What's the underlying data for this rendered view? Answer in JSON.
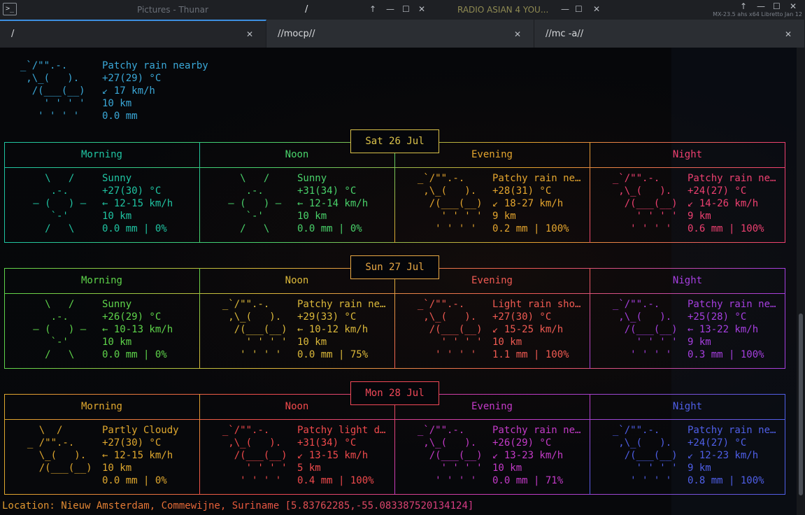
{
  "taskbar": {
    "menu_icon_glyph": ">_",
    "windows": [
      {
        "title": "Pictures - Thunar"
      },
      {
        "title": "/"
      },
      {
        "title": "RADIO ASIAN 4 YOU..."
      }
    ],
    "window_controls": {
      "minimize": "—",
      "maximize": "☐",
      "close": "✕"
    },
    "tray_controls": {
      "up": "↑",
      "minimize": "—",
      "maximize": "☐",
      "close": "✕"
    },
    "sysinfo": "MX-23.5  ahs  x64 Libretto  Jan 12"
  },
  "tabs": [
    {
      "label": "/",
      "active": true
    },
    {
      "label": "//mocp//",
      "active": false
    },
    {
      "label": "//mc -a//",
      "active": false
    }
  ],
  "tab_close_glyph": "✕",
  "current": {
    "art": [
      " _`/\"\".-.    ",
      "  ,\\_(   ).  ",
      "   /(___(__) ",
      "     ' ' ' ' ",
      "    ' ' ' '  "
    ],
    "lines": [
      "Patchy rain nearby",
      "+27(29) °C",
      "↙ 17 km/h",
      "10 km",
      "0.0 mm"
    ],
    "color": "#3aa8d8"
  },
  "days": [
    {
      "date": "Sat 26 Jul",
      "date_color": "#d9c14a",
      "periods": [
        {
          "name": "Morning",
          "color": "#1fc4a2",
          "art": [
            "    \\   /    ",
            "     .-.     ",
            "  ― (   ) ―  ",
            "     `-'     ",
            "    /   \\    "
          ],
          "lines": [
            "Sunny",
            "+27(30) °C",
            "← 12-15 km/h",
            "10 km",
            "0.0 mm | 0%"
          ]
        },
        {
          "name": "Noon",
          "color": "#49d26a",
          "art": [
            "    \\   /    ",
            "     .-.     ",
            "  ― (   ) ―  ",
            "     `-'     ",
            "    /   \\    "
          ],
          "lines": [
            "Sunny",
            "+31(34) °C",
            "← 12-14 km/h",
            "10 km",
            "0.0 mm | 0%"
          ]
        },
        {
          "name": "Evening",
          "color": "#e4a52e",
          "art": [
            " _`/\"\".-.    ",
            "  ,\\_(   ).  ",
            "   /(___(__) ",
            "     ' ' ' ' ",
            "    ' ' ' '  "
          ],
          "lines": [
            "Patchy rain ne…",
            "+28(31) °C",
            "↙ 18-27 km/h",
            "9 km",
            "0.2 mm | 100%"
          ]
        },
        {
          "name": "Night",
          "color": "#ee4070",
          "art": [
            " _`/\"\".-.    ",
            "  ,\\_(   ).  ",
            "   /(___(__) ",
            "     ' ' ' ' ",
            "    ' ' ' '  "
          ],
          "lines": [
            "Patchy rain ne…",
            "+24(27) °C",
            "↙ 14-26 km/h",
            "9 km",
            "0.6 mm | 100%"
          ]
        }
      ]
    },
    {
      "date": "Sun 27 Jul",
      "date_color": "#e8a844",
      "periods": [
        {
          "name": "Morning",
          "color": "#5ed44a",
          "art": [
            "    \\   /    ",
            "     .-.     ",
            "  ― (   ) ―  ",
            "     `-'     ",
            "    /   \\    "
          ],
          "lines": [
            "Sunny",
            "+26(29) °C",
            "← 10-13 km/h",
            "10 km",
            "0.0 mm | 0%"
          ]
        },
        {
          "name": "Noon",
          "color": "#dcb93a",
          "art": [
            " _`/\"\".-.    ",
            "  ,\\_(   ).  ",
            "   /(___(__) ",
            "     ' ' ' ' ",
            "    ' ' ' '  "
          ],
          "lines": [
            "Patchy rain ne…",
            "+29(33) °C",
            "← 10-12 km/h",
            "10 km",
            "0.0 mm | 75%"
          ]
        },
        {
          "name": "Evening",
          "color": "#f05a52",
          "art": [
            " _`/\"\".-.    ",
            "  ,\\_(   ).  ",
            "   /(___(__) ",
            "     ' ' ' ' ",
            "    ' ' ' '  "
          ],
          "lines": [
            "Light rain sho…",
            "+27(30) °C",
            "↙ 15-25 km/h",
            "10 km",
            "1.1 mm | 100%"
          ]
        },
        {
          "name": "Night",
          "color": "#a63fe0",
          "art": [
            " _`/\"\".-.    ",
            "  ,\\_(   ).  ",
            "   /(___(__) ",
            "     ' ' ' ' ",
            "    ' ' ' '  "
          ],
          "lines": [
            "Patchy rain ne…",
            "+25(28) °C",
            "← 13-22 km/h",
            "9 km",
            "0.3 mm | 100%"
          ]
        }
      ]
    },
    {
      "date": "Mon 28 Jul",
      "date_color": "#f04858",
      "periods": [
        {
          "name": "Morning",
          "color": "#e0a82e",
          "art": [
            "   \\  /      ",
            " _ /\"\".-.    ",
            "   \\_(   ).  ",
            "   /(___(__) ",
            "             "
          ],
          "lines": [
            "Partly Cloudy",
            "+27(30) °C",
            "← 12-15 km/h",
            "10 km",
            "0.0 mm | 0%"
          ]
        },
        {
          "name": "Noon",
          "color": "#f04a4c",
          "art": [
            " _`/\"\".-.    ",
            "  ,\\_(   ).  ",
            "   /(___(__) ",
            "     ' ' ' ' ",
            "    ' ' ' '  "
          ],
          "lines": [
            "Patchy light d…",
            "+31(34) °C",
            "↙ 13-15 km/h",
            "5 km",
            "0.4 mm | 100%"
          ]
        },
        {
          "name": "Evening",
          "color": "#c43ac8",
          "art": [
            " _`/\"\".-.    ",
            "  ,\\_(   ).  ",
            "   /(___(__) ",
            "     ' ' ' ' ",
            "    ' ' ' '  "
          ],
          "lines": [
            "Patchy rain ne…",
            "+26(29) °C",
            "↙ 13-23 km/h",
            "10 km",
            "0.0 mm | 71%"
          ]
        },
        {
          "name": "Night",
          "color": "#4f5fe8",
          "art": [
            " _`/\"\".-.    ",
            "  ,\\_(   ).  ",
            "   /(___(__) ",
            "     ' ' ' ' ",
            "    ' ' ' '  "
          ],
          "lines": [
            "Patchy rain ne…",
            "+24(27) °C",
            "↙ 12-23 km/h",
            "9 km",
            "0.8 mm | 100%"
          ]
        }
      ]
    }
  ],
  "location": {
    "text": "Location: Nieuw Amsterdam, Commewijne, Suriname [5.83762285,-55.083387520134124]",
    "colors": [
      "#e3a030",
      "#ea5a3a",
      "#d83a8a"
    ]
  }
}
